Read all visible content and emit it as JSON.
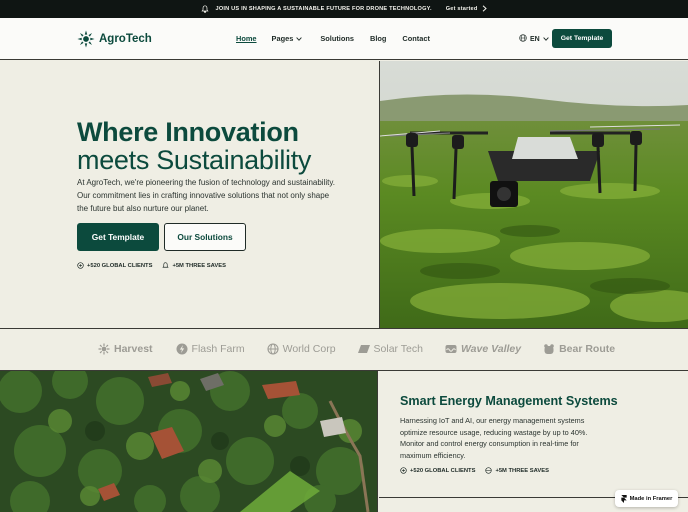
{
  "announcement": {
    "text": "JOIN US IN SHAPING A SUSTAINABLE FUTURE FOR DRONE TECHNOLOGY.",
    "cta": "Get started"
  },
  "nav": {
    "brand": "AgroTech",
    "items": [
      {
        "label": "Home",
        "active": true
      },
      {
        "label": "Pages",
        "has_dropdown": true
      },
      {
        "label": "Solutions"
      },
      {
        "label": "Blog"
      },
      {
        "label": "Contact"
      }
    ],
    "language": "EN",
    "cta": "Get Template"
  },
  "hero": {
    "title_line1": "Where Innovation",
    "title_line2": "meets Sustainability",
    "description": "At AgroTech, we're pioneering the fusion of technology and sustainability. Our commitment lies in crafting innovative solutions that not only shape the future but also nurture our planet.",
    "primary_button": "Get Template",
    "secondary_button": "Our Solutions",
    "stats": [
      "+520 GLOBAL CLIENTS",
      "+5M THREE SAVES"
    ]
  },
  "brands": [
    "Harvest",
    "Flash Farm",
    "World Corp",
    "Solar Tech",
    "Wave Valley",
    "Bear Route"
  ],
  "feature": {
    "title": "Smart Energy Management Systems",
    "description": "Harnessing IoT and AI, our energy management systems optimize resource usage, reducing wastage by up to 40%. Monitor and control energy consumption in real-time for maximum efficiency.",
    "stats": [
      "+520 GLOBAL CLIENTS",
      "+5M THREE SAVES"
    ]
  },
  "badge": "Made in Framer",
  "colors": {
    "primary": "#0c4a3d",
    "background": "#efeee4",
    "announcement_bg": "#0f1513",
    "brand_gray": "#9d9c95"
  }
}
